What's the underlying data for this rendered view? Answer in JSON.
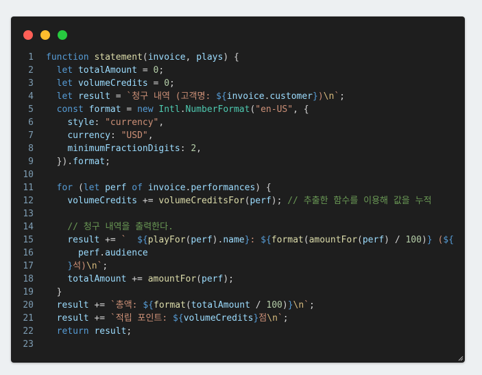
{
  "window": {
    "controls": [
      "close",
      "minimize",
      "maximize"
    ]
  },
  "code": {
    "lines": [
      [
        [
          "kw",
          "function"
        ],
        [
          "p",
          " "
        ],
        [
          "fn",
          "statement"
        ],
        [
          "p",
          "("
        ],
        [
          "var",
          "invoice"
        ],
        [
          "p",
          ", "
        ],
        [
          "var",
          "plays"
        ],
        [
          "p",
          ") {"
        ]
      ],
      [
        [
          "p",
          "  "
        ],
        [
          "kw",
          "let"
        ],
        [
          "p",
          " "
        ],
        [
          "var",
          "totalAmount"
        ],
        [
          "p",
          " = "
        ],
        [
          "num",
          "0"
        ],
        [
          "p",
          ";"
        ]
      ],
      [
        [
          "p",
          "  "
        ],
        [
          "kw",
          "let"
        ],
        [
          "p",
          " "
        ],
        [
          "var",
          "volumeCredits"
        ],
        [
          "p",
          " = "
        ],
        [
          "num",
          "0"
        ],
        [
          "p",
          ";"
        ]
      ],
      [
        [
          "p",
          "  "
        ],
        [
          "kw",
          "let"
        ],
        [
          "p",
          " "
        ],
        [
          "var",
          "result"
        ],
        [
          "p",
          " = "
        ],
        [
          "str",
          "`청구 내역 (고객명: "
        ],
        [
          "tpl",
          "${"
        ],
        [
          "var",
          "invoice"
        ],
        [
          "p",
          "."
        ],
        [
          "var",
          "customer"
        ],
        [
          "tpl",
          "}"
        ],
        [
          "str",
          ")"
        ],
        [
          "esc",
          "\\n"
        ],
        [
          "str",
          "`"
        ],
        [
          "p",
          ";"
        ]
      ],
      [
        [
          "p",
          "  "
        ],
        [
          "kw",
          "const"
        ],
        [
          "p",
          " "
        ],
        [
          "var",
          "format"
        ],
        [
          "p",
          " = "
        ],
        [
          "kw",
          "new"
        ],
        [
          "p",
          " "
        ],
        [
          "cls",
          "Intl"
        ],
        [
          "p",
          "."
        ],
        [
          "cls",
          "NumberFormat"
        ],
        [
          "p",
          "("
        ],
        [
          "str",
          "\"en-US\""
        ],
        [
          "p",
          ", {"
        ]
      ],
      [
        [
          "p",
          "    "
        ],
        [
          "var",
          "style"
        ],
        [
          "p",
          ": "
        ],
        [
          "str",
          "\"currency\""
        ],
        [
          "p",
          ","
        ]
      ],
      [
        [
          "p",
          "    "
        ],
        [
          "var",
          "currency"
        ],
        [
          "p",
          ": "
        ],
        [
          "str",
          "\"USD\""
        ],
        [
          "p",
          ","
        ]
      ],
      [
        [
          "p",
          "    "
        ],
        [
          "var",
          "minimumFractionDigits"
        ],
        [
          "p",
          ": "
        ],
        [
          "num",
          "2"
        ],
        [
          "p",
          ","
        ]
      ],
      [
        [
          "p",
          "  })."
        ],
        [
          "var",
          "format"
        ],
        [
          "p",
          ";"
        ]
      ],
      [],
      [
        [
          "p",
          "  "
        ],
        [
          "kw",
          "for"
        ],
        [
          "p",
          " ("
        ],
        [
          "kw",
          "let"
        ],
        [
          "p",
          " "
        ],
        [
          "var",
          "perf"
        ],
        [
          "p",
          " "
        ],
        [
          "kw",
          "of"
        ],
        [
          "p",
          " "
        ],
        [
          "var",
          "invoice"
        ],
        [
          "p",
          "."
        ],
        [
          "var",
          "performances"
        ],
        [
          "p",
          ") {"
        ]
      ],
      [
        [
          "p",
          "    "
        ],
        [
          "var",
          "volumeCredits"
        ],
        [
          "p",
          " += "
        ],
        [
          "fn",
          "volumeCreditsFor"
        ],
        [
          "p",
          "("
        ],
        [
          "var",
          "perf"
        ],
        [
          "p",
          "); "
        ],
        [
          "cmt",
          "// 추출한 함수를 이용해 값을 누적"
        ]
      ],
      [],
      [
        [
          "p",
          "    "
        ],
        [
          "cmt",
          "// 청구 내역을 출력한다."
        ]
      ],
      [
        [
          "p",
          "    "
        ],
        [
          "var",
          "result"
        ],
        [
          "p",
          " += "
        ],
        [
          "str",
          "`  "
        ],
        [
          "tpl",
          "${"
        ],
        [
          "fn",
          "playFor"
        ],
        [
          "p",
          "("
        ],
        [
          "var",
          "perf"
        ],
        [
          "p",
          ")."
        ],
        [
          "var",
          "name"
        ],
        [
          "tpl",
          "}"
        ],
        [
          "str",
          ": "
        ],
        [
          "tpl",
          "${"
        ],
        [
          "fn",
          "format"
        ],
        [
          "p",
          "("
        ],
        [
          "fn",
          "amountFor"
        ],
        [
          "p",
          "("
        ],
        [
          "var",
          "perf"
        ],
        [
          "p",
          ") / "
        ],
        [
          "num",
          "100"
        ],
        [
          "p",
          ")"
        ],
        [
          "tpl",
          "}"
        ],
        [
          "str",
          " ("
        ],
        [
          "tpl",
          "${"
        ]
      ],
      [
        [
          "p",
          "      "
        ],
        [
          "var",
          "perf"
        ],
        [
          "p",
          "."
        ],
        [
          "var",
          "audience"
        ]
      ],
      [
        [
          "p",
          "    "
        ],
        [
          "tpl",
          "}"
        ],
        [
          "str",
          "석)"
        ],
        [
          "esc",
          "\\n"
        ],
        [
          "str",
          "`"
        ],
        [
          "p",
          ";"
        ]
      ],
      [
        [
          "p",
          "    "
        ],
        [
          "var",
          "totalAmount"
        ],
        [
          "p",
          " += "
        ],
        [
          "fn",
          "amountFor"
        ],
        [
          "p",
          "("
        ],
        [
          "var",
          "perf"
        ],
        [
          "p",
          ");"
        ]
      ],
      [
        [
          "p",
          "  }"
        ]
      ],
      [
        [
          "p",
          "  "
        ],
        [
          "var",
          "result"
        ],
        [
          "p",
          " += "
        ],
        [
          "str",
          "`총액: "
        ],
        [
          "tpl",
          "${"
        ],
        [
          "fn",
          "format"
        ],
        [
          "p",
          "("
        ],
        [
          "var",
          "totalAmount"
        ],
        [
          "p",
          " / "
        ],
        [
          "num",
          "100"
        ],
        [
          "p",
          ")"
        ],
        [
          "tpl",
          "}"
        ],
        [
          "esc",
          "\\n"
        ],
        [
          "str",
          "`"
        ],
        [
          "p",
          ";"
        ]
      ],
      [
        [
          "p",
          "  "
        ],
        [
          "var",
          "result"
        ],
        [
          "p",
          " += "
        ],
        [
          "str",
          "`적립 포인트: "
        ],
        [
          "tpl",
          "${"
        ],
        [
          "var",
          "volumeCredits"
        ],
        [
          "tpl",
          "}"
        ],
        [
          "str",
          "점"
        ],
        [
          "esc",
          "\\n"
        ],
        [
          "str",
          "`"
        ],
        [
          "p",
          ";"
        ]
      ],
      [
        [
          "p",
          "  "
        ],
        [
          "kw",
          "return"
        ],
        [
          "p",
          " "
        ],
        [
          "var",
          "result"
        ],
        [
          "p",
          ";"
        ]
      ],
      []
    ]
  }
}
